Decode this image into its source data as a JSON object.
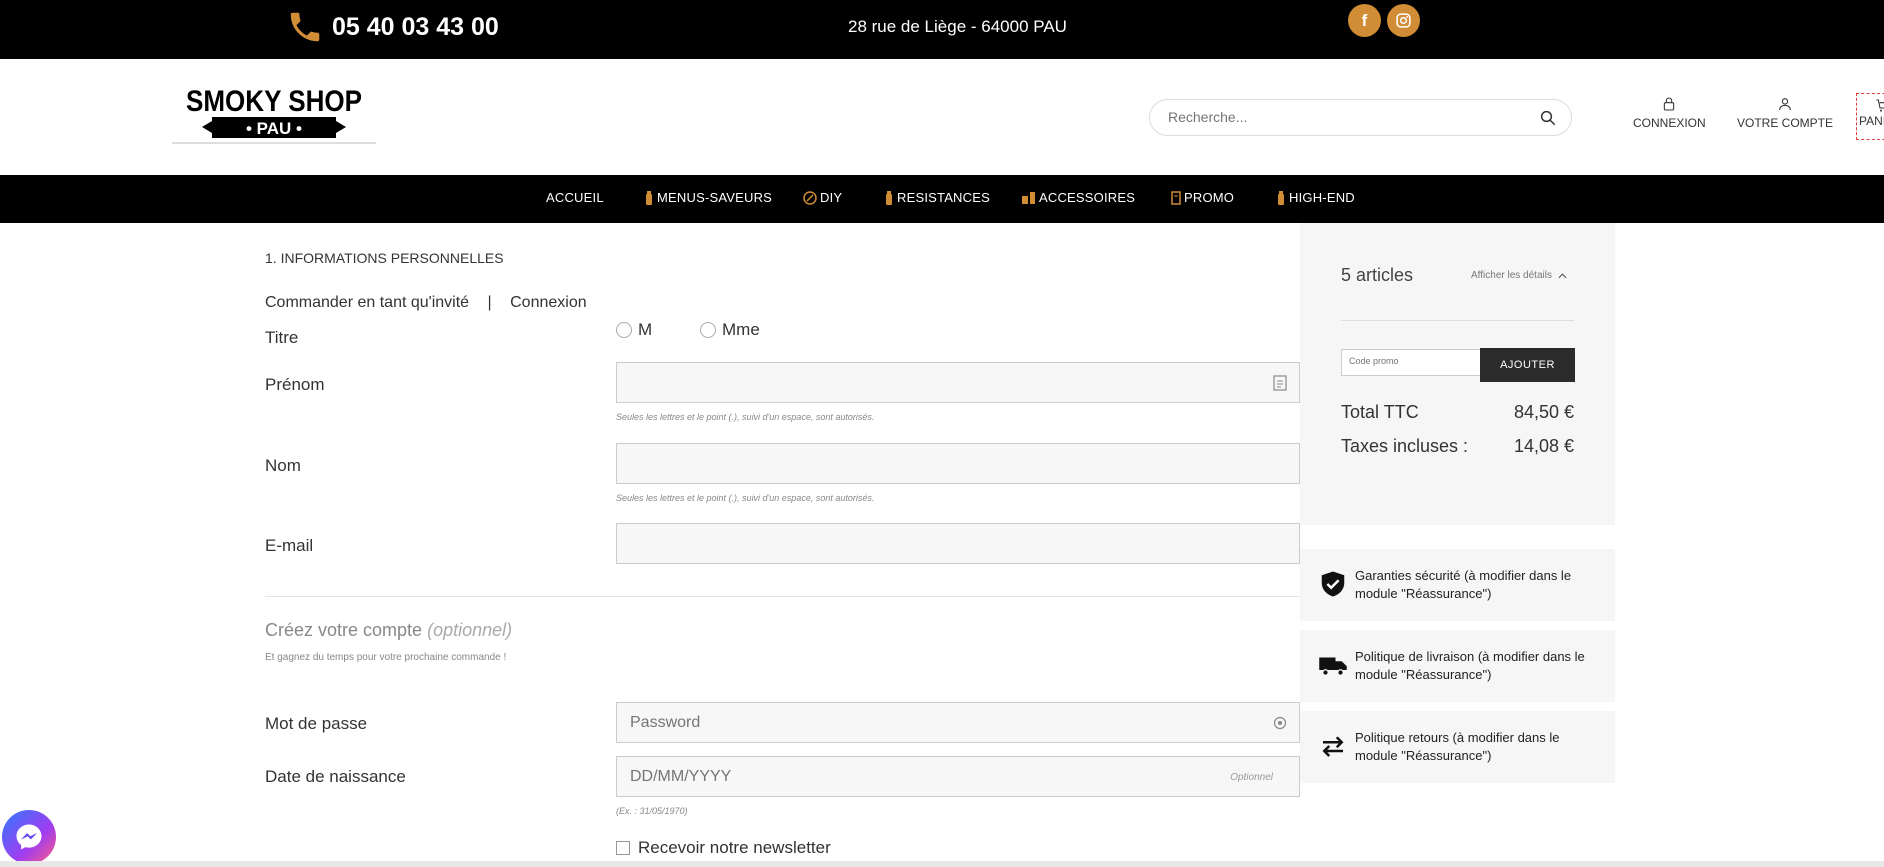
{
  "topbar": {
    "phone": "05 40 03 43 00",
    "address": "28 rue de Liège - 64000 PAU",
    "social": [
      {
        "icon": "facebook-icon",
        "glyph": "f"
      },
      {
        "icon": "instagram-icon",
        "glyph": "◎"
      }
    ]
  },
  "header": {
    "logo": {
      "line1": "SMOKY SHOP",
      "line2": "• PAU •"
    },
    "search_placeholder": "Recherche...",
    "login_label": "CONNEXION",
    "account_label": "VOTRE COMPTE",
    "cart_label": "PANI"
  },
  "nav": {
    "items": [
      {
        "label": "ACCUEIL"
      },
      {
        "label": "MENUS-SAVEURS"
      },
      {
        "label": "DIY"
      },
      {
        "label": "RESISTANCES"
      },
      {
        "label": "ACCESSOIRES"
      },
      {
        "label": "PROMO"
      },
      {
        "label": "HIGH-END"
      }
    ]
  },
  "form": {
    "step_title": "1. INFORMATIONS PERSONNELLES",
    "tab_guest": "Commander en tant qu'invité",
    "tab_sep": "|",
    "tab_login": "Connexion",
    "title_label": "Titre",
    "title_options": [
      "M",
      "Mme"
    ],
    "firstname_label": "Prénom",
    "firstname_hint": "Seules les lettres et le point (.), suivi d'un espace, sont autorisés.",
    "lastname_label": "Nom",
    "lastname_hint": "Seules les lettres et le point (.), suivi d'un espace, sont autorisés.",
    "email_label": "E-mail",
    "create_title": "Créez votre compte",
    "create_optional": "(optionnel)",
    "create_sub": "Et gagnez du temps pour votre prochaine commande !",
    "password_label": "Mot de passe",
    "password_placeholder": "Password",
    "birthdate_label": "Date de naissance",
    "birthdate_placeholder": "DD/MM/YYYY",
    "birthdate_optional": "Optionnel",
    "birthdate_hint": "(Ex. : 31/05/1970)",
    "newsletter_label": "Recevoir notre newsletter"
  },
  "summary": {
    "count": "5 articles",
    "details_toggle": "Afficher les détails",
    "promo_placeholder": "Code promo",
    "promo_button": "AJOUTER",
    "total_label": "Total TTC",
    "total_value": "84,50 €",
    "tax_label": "Taxes incluses :",
    "tax_value": "14,08 €"
  },
  "reassurance": [
    {
      "icon": "shield-check-icon",
      "text": "Garanties sécurité (à modifier dans le module \"Réassurance\")"
    },
    {
      "icon": "truck-icon",
      "text": "Politique de livraison (à modifier dans le module \"Réassurance\")"
    },
    {
      "icon": "exchange-arrows-icon",
      "text": "Politique retours (à modifier dans le module \"Réassurance\")"
    }
  ],
  "colors": {
    "accent": "#d18c36",
    "dark": "#000000",
    "button": "#2b2b2b",
    "panel": "#f6f6f6"
  }
}
